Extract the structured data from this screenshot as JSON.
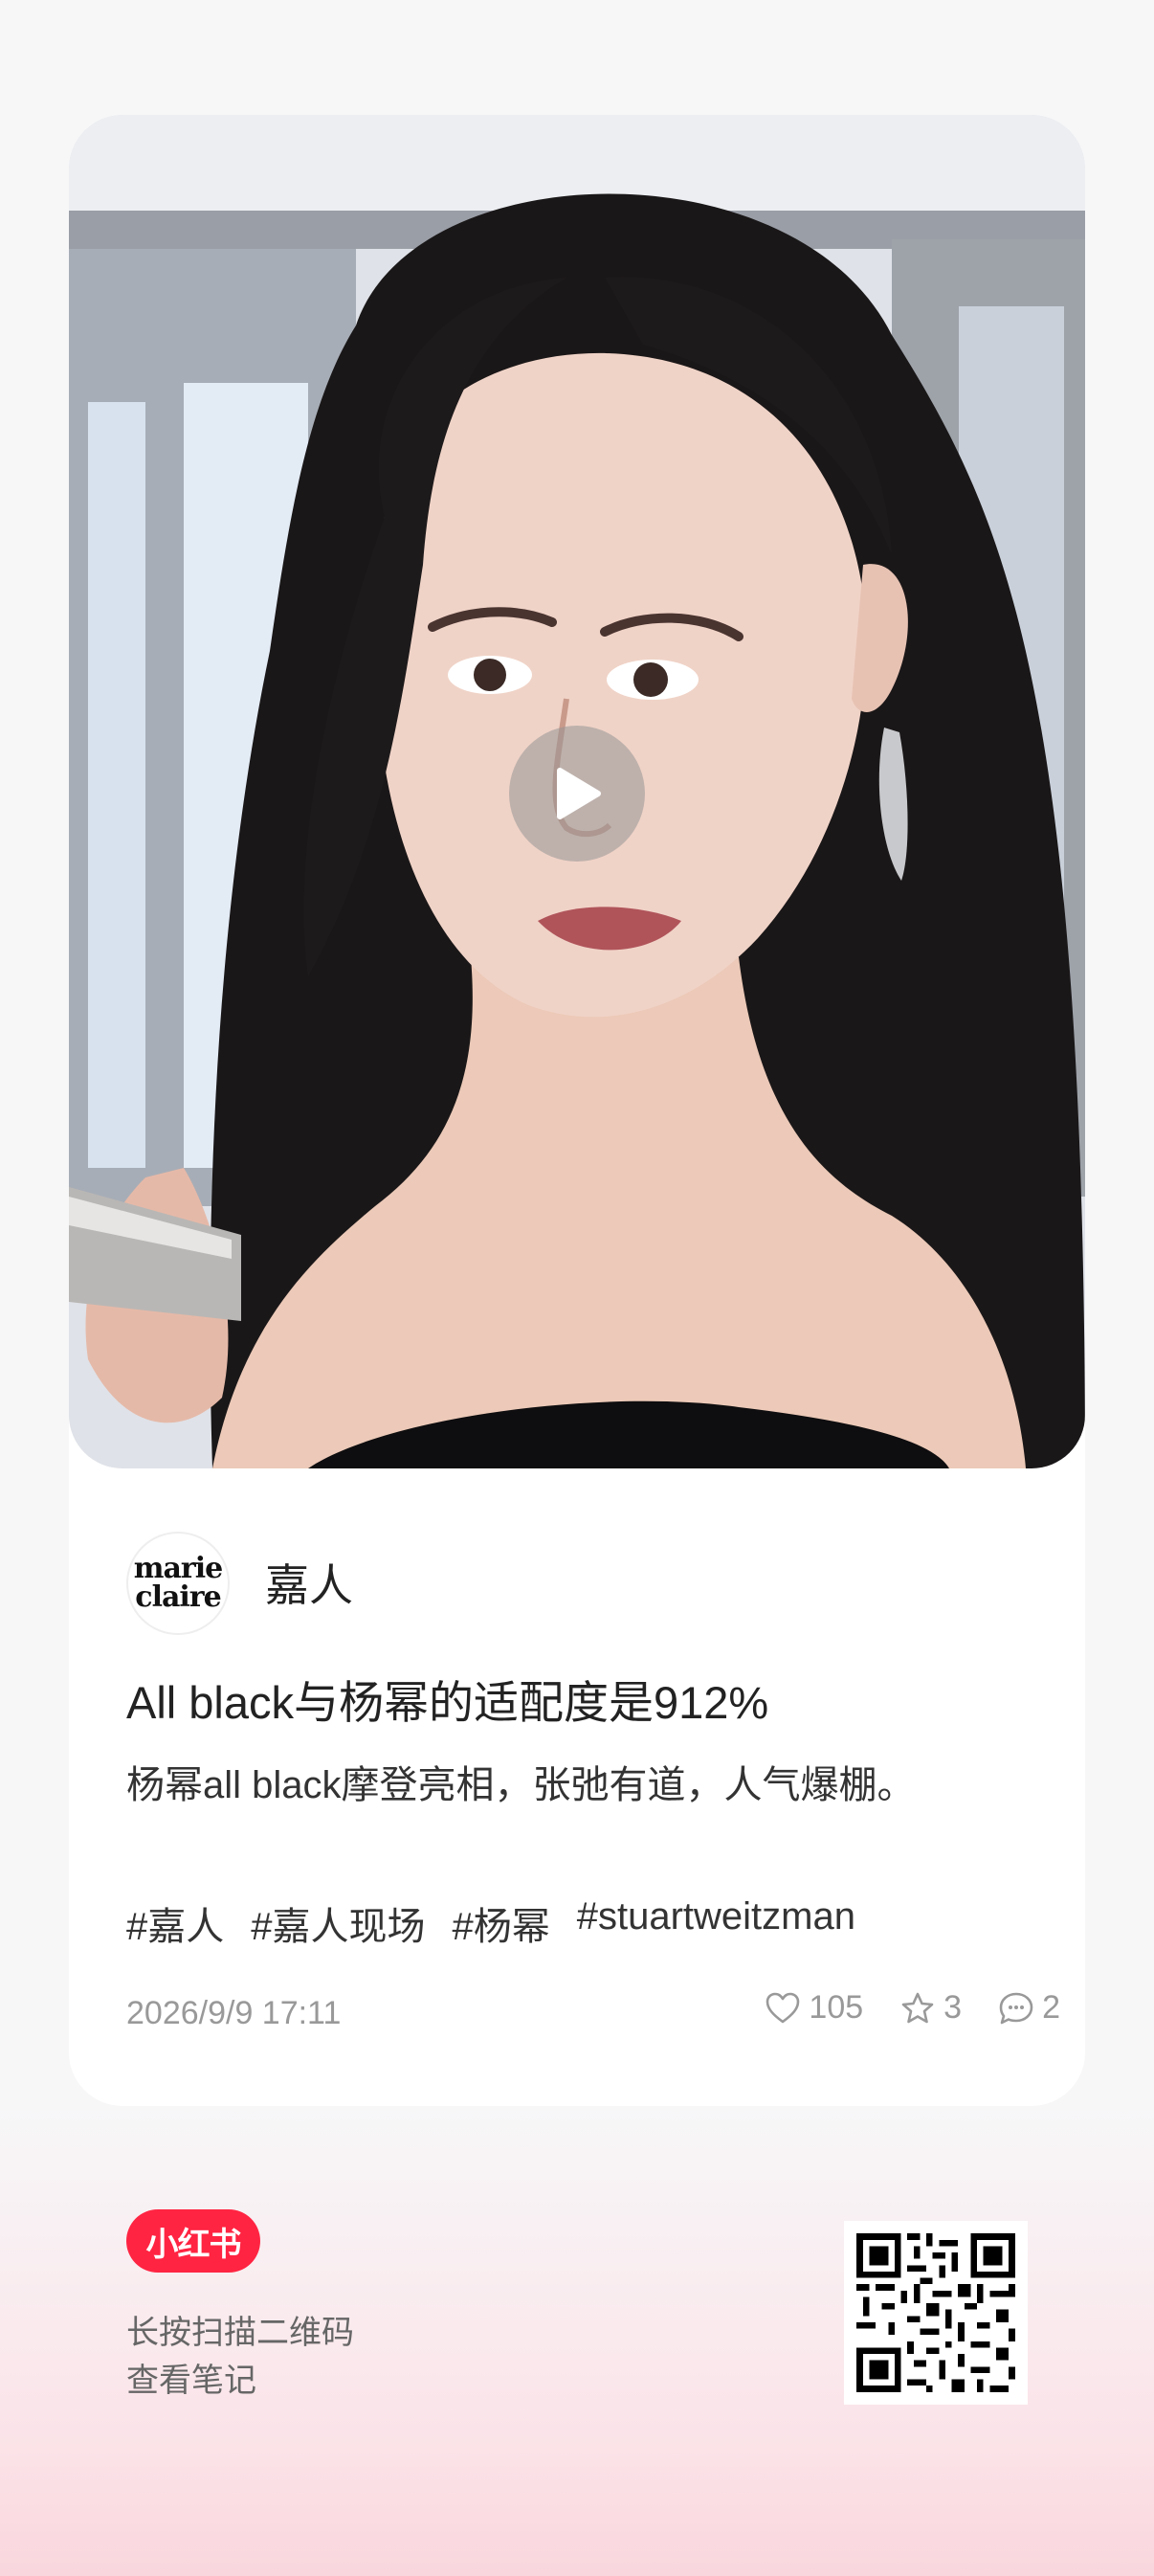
{
  "post": {
    "author": "嘉人",
    "avatar_logo_line1": "marie",
    "avatar_logo_line2": "claire",
    "title": "All black与杨幂的适配度是912%",
    "description": "杨幂all black摩登亮相，张弛有道，人气爆棚。",
    "tags": [
      "#嘉人",
      "#嘉人现场",
      "#杨幂",
      "#stuartweitzman"
    ],
    "date": "2026/9/9 17:11",
    "likes": "105",
    "collects": "3",
    "comments": "2"
  },
  "footer": {
    "brand": "小红书",
    "scan_line1": "长按扫描二维码",
    "scan_line2": "查看笔记"
  },
  "icons": {
    "play": "play-icon",
    "like": "heart-icon",
    "collect": "star-icon",
    "comment": "comment-icon"
  },
  "colors": {
    "brand": "#ff2442",
    "meta_text": "#999999"
  }
}
